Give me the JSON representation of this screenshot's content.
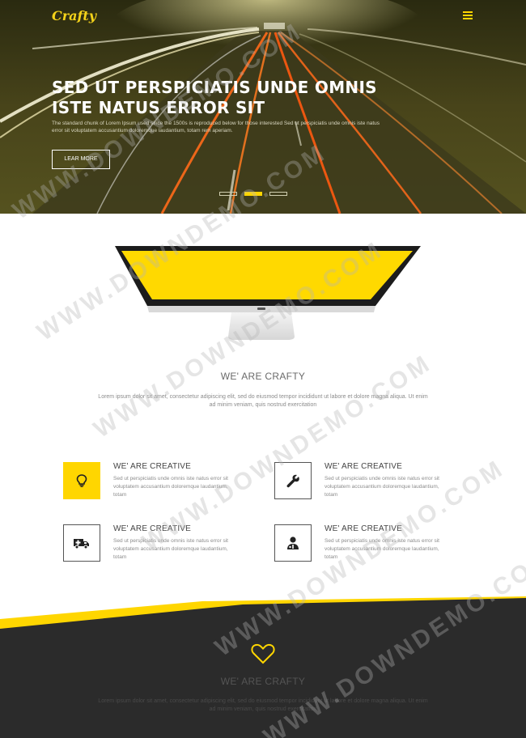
{
  "header": {
    "logo": "Crafty",
    "menu_icon": "hamburger-menu-icon"
  },
  "hero": {
    "title": "SED UT PERSPICIATIS UNDE OMNIS ISTE NATUS ERROR SIT",
    "text": "The standard chunk of Lorem Ipsum used since the 1500s is reproduced below for those interested Sed ut perspiciatis unde omnis iste natus error sit voluptatem accusantium doloremque laudantium, totam rem aperiam.",
    "button_label": "LEAR MORE",
    "slides": 3,
    "active_slide": 2
  },
  "about": {
    "title": "WE' ARE CRAFTY",
    "text": "Lorem ipsum dolor sit amet, consectetur adipiscing elit, sed do eiusmod tempor incididunt ut labore et dolore magna aliqua. Ut enim ad minim veniam, quis nostrud exercitation"
  },
  "features": [
    {
      "icon": "lightbulb-icon",
      "title": "WE' ARE CREATIVE",
      "text": "Sed ut perspiciatis unde omnis iste natus error sit voluptatem accusantium doloremque laudantium, totam"
    },
    {
      "icon": "wrench-icon",
      "title": "WE' ARE CREATIVE",
      "text": "Sed ut perspiciatis unde omnis iste natus error sit voluptatem accusantium doloremque laudantium, totam"
    },
    {
      "icon": "ambulance-icon",
      "title": "WE' ARE CREATIVE",
      "text": "Sed ut perspiciatis unde omnis iste natus error sit voluptatem accusantium doloremque laudantium, totam"
    },
    {
      "icon": "doctor-icon",
      "title": "WE' ARE CREATIVE",
      "text": "Sed ut perspiciatis unde omnis iste natus error sit voluptatem accusantium doloremque laudantium, totam"
    }
  ],
  "footer_section": {
    "icon": "heart-icon",
    "title": "WE' ARE CRAFTY",
    "text": "Lorem ipsum dolor sit amet, consectetur adipiscing elit, sed do eiusmod tempor incididunt ut labore et dolore magna aliqua. Ut enim ad minim veniam, quis nostrud exercitation"
  },
  "watermark": "WWW.DOWNDEMO.COM",
  "colors": {
    "accent": "#ffd600",
    "dark": "#2b2b2b",
    "hero_tint": "#4a4718"
  }
}
